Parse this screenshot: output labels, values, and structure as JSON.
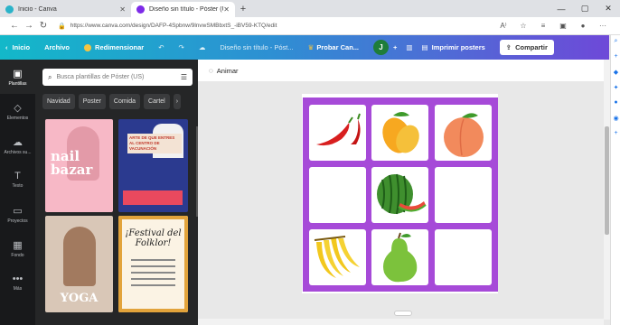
{
  "browser": {
    "tabs": [
      {
        "title": "Inicio - Canva",
        "active": false,
        "favicon_color": "#2bb3c9"
      },
      {
        "title": "Diseño sin título - Póster (US)",
        "active": true,
        "favicon_color": "#7d2ae8"
      }
    ],
    "new_tab": "+",
    "url": "https://www.canva.com/design/DAFP-4Spbnw/9lnvwSMBbxtS_-iBV59-KTQ/edit",
    "window_controls": [
      "—",
      "▢",
      "✕"
    ]
  },
  "toolbar": {
    "home": "Inicio",
    "file": "Archivo",
    "resize": "Redimensionar",
    "title": "Diseño sin título - Póst...",
    "upgrade": "Probar Can...",
    "avatar_letter": "J",
    "print": "Imprimir posters",
    "share": "Compartir"
  },
  "rail": [
    {
      "label": "Plantillas",
      "icon": "▣",
      "active": true
    },
    {
      "label": "Elementos",
      "icon": "◇",
      "active": false
    },
    {
      "label": "Archivos su...",
      "icon": "☁",
      "active": false
    },
    {
      "label": "Texto",
      "icon": "T",
      "active": false
    },
    {
      "label": "Proyectos",
      "icon": "▭",
      "active": false
    },
    {
      "label": "Fondo",
      "icon": "▦",
      "active": false
    },
    {
      "label": "Más",
      "icon": "•••",
      "active": false
    }
  ],
  "panel": {
    "search_placeholder": "Busca plantillas de Póster (US)",
    "chips": [
      "Navidad",
      "Poster",
      "Comida",
      "Cartel"
    ],
    "templates": [
      {
        "text": "nail bazar"
      },
      {
        "text": "ARTE DE QUE ENTRES AL CENTRO DE VACUNACIÓN"
      },
      {
        "text": "YOGA"
      },
      {
        "text": "¡Festival del Folklor!"
      }
    ]
  },
  "editor": {
    "animate": "Animar",
    "accent": "#a64ad8"
  }
}
